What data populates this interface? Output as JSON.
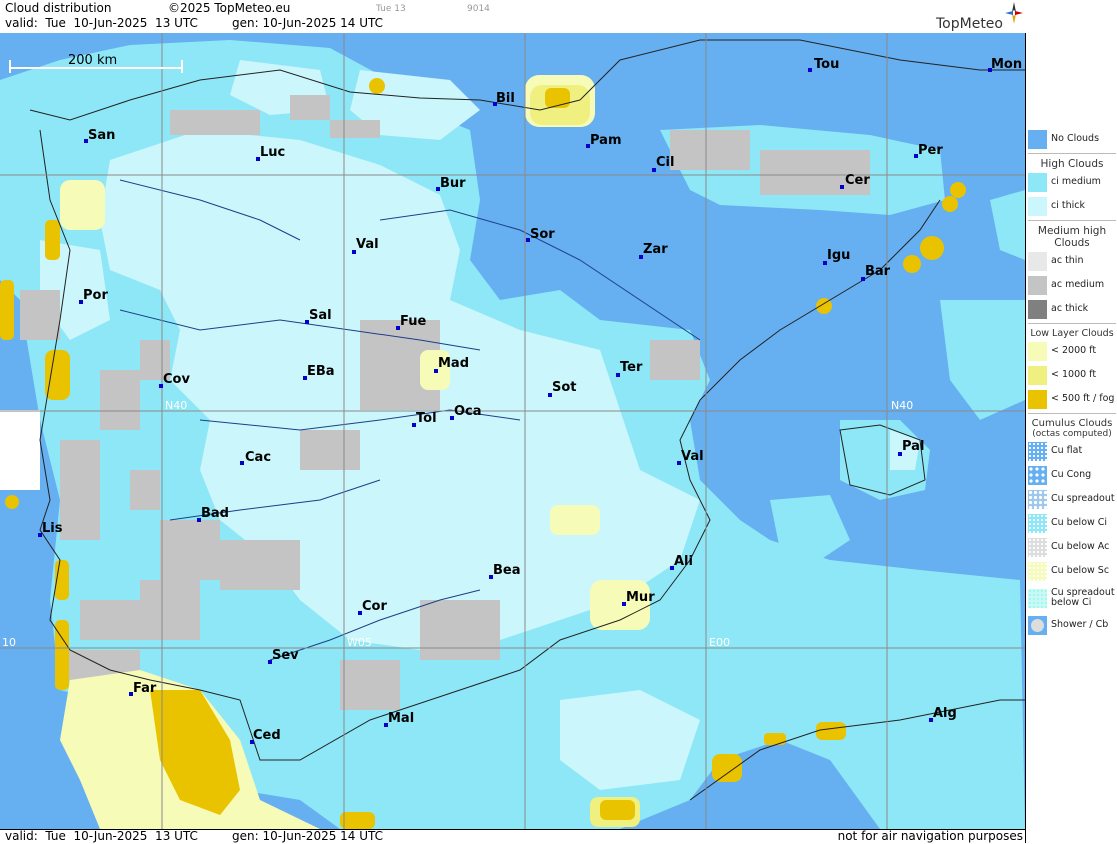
{
  "header": {
    "title": "Cloud distribution",
    "copyright": "©2025 TopMeteo.eu",
    "small_day": "Tue 13",
    "small_code": "9014",
    "valid": "valid:  Tue  10-Jun-2025  13 UTC",
    "gen": "gen: 10-Jun-2025 14 UTC",
    "logo": "TopMeteo"
  },
  "map": {
    "scale_label": "200 km",
    "grid_labels": [
      "N40",
      "N40",
      "W05",
      "E00",
      "10"
    ],
    "colors": {
      "no_clouds": "#66aff0",
      "ci_medium": "#8ee7f6",
      "ci_thick": "#cbf6fb",
      "low_2000": "#f6fbb8",
      "low_1000": "#f0f080",
      "low_500": "#eac300",
      "ac": "#c4c4c4",
      "city_marker": "#0000cc"
    },
    "cities": [
      "Tou",
      "Mon",
      "Bil",
      "San",
      "Pam",
      "Luc",
      "Cil",
      "Per",
      "Cer",
      "Bur",
      "Sor",
      "Val",
      "Zar",
      "Igu",
      "Bar",
      "Por",
      "Sal",
      "Fue",
      "Mad",
      "Cov",
      "EBa",
      "Ter",
      "Sot",
      "Tol",
      "Oca",
      "Pal",
      "Cac",
      "Val",
      "Bad",
      "Lis",
      "Ali",
      "Bea",
      "Mur",
      "Cor",
      "Sev",
      "Far",
      "Alg",
      "Mal",
      "Ced"
    ]
  },
  "footer": {
    "valid": "valid:  Tue  10-Jun-2025  13 UTC",
    "gen": "gen: 10-Jun-2025 14 UTC",
    "note": "not for air navigation purposes"
  },
  "legend": {
    "no_clouds": "No Clouds",
    "high_head": "High Clouds",
    "ci_medium": "ci medium",
    "ci_thick": "ci thick",
    "medium_head": "Medium high Clouds",
    "ac_thin": "ac thin",
    "ac_medium": "ac medium",
    "ac_thick": "ac thick",
    "low_head": "Low Layer Clouds",
    "low_2000": "< 2000 ft",
    "low_1000": "< 1000 ft",
    "low_500": "< 500 ft / fog",
    "cu_head": "Cumulus Clouds",
    "cu_sub": "(octas computed)",
    "cu_flat": "Cu flat",
    "cu_cong": "Cu Cong",
    "cu_spreadout": "Cu spreadout",
    "cu_below_ci": "Cu below Ci",
    "cu_below_ac": "Cu below Ac",
    "cu_below_sc": "Cu below Sc",
    "cu_spread_ci": "Cu spreadout below Ci",
    "shower": "Shower / Cb"
  }
}
